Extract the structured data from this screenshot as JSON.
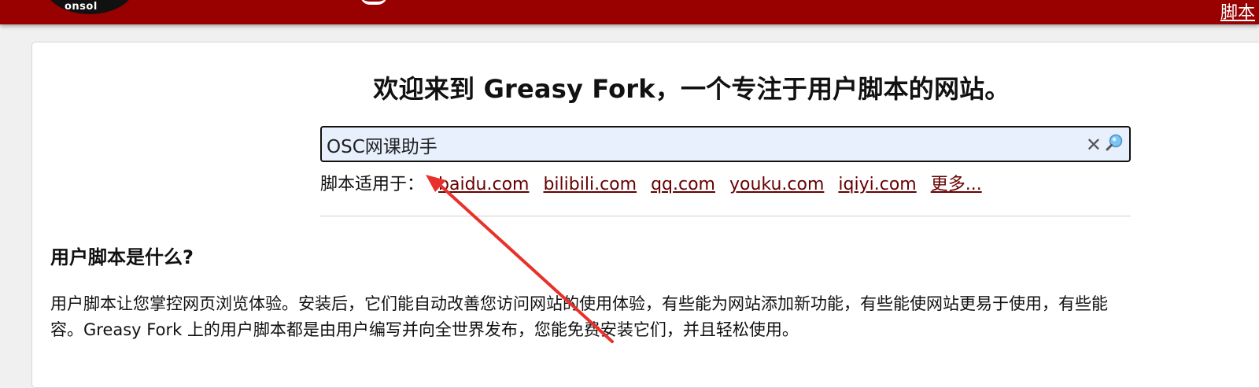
{
  "header": {
    "logo_text": "onsol",
    "nav_link": "脚本"
  },
  "welcome": {
    "title": "欢迎来到 Greasy Fork，一个专注于用户脚本的网站。"
  },
  "search": {
    "value": "OSC网课助手",
    "placeholder": ""
  },
  "sites": {
    "label": "脚本适用于：",
    "links": [
      "baidu.com",
      "bilibili.com",
      "qq.com",
      "youku.com",
      "iqiyi.com",
      "更多..."
    ]
  },
  "about": {
    "title": "用户脚本是什么?",
    "line1": "用户脚本让您掌控网页浏览体验。安装后，它们能自动改善您访问网站的使用体验，有些能为网站添加新功能，有些能使网站更易于使用，有些能",
    "line2": "容。Greasy Fork 上的用户脚本都是由用户编写并向全世界发布，您能免费安装它们，并且轻松使用。"
  },
  "colors": {
    "header_bg": "#990000",
    "link": "#670000",
    "search_bg": "#e8f0fe",
    "annotation_arrow": "#e8312a"
  },
  "icons": {
    "clear": "close-icon",
    "search": "search-icon"
  }
}
